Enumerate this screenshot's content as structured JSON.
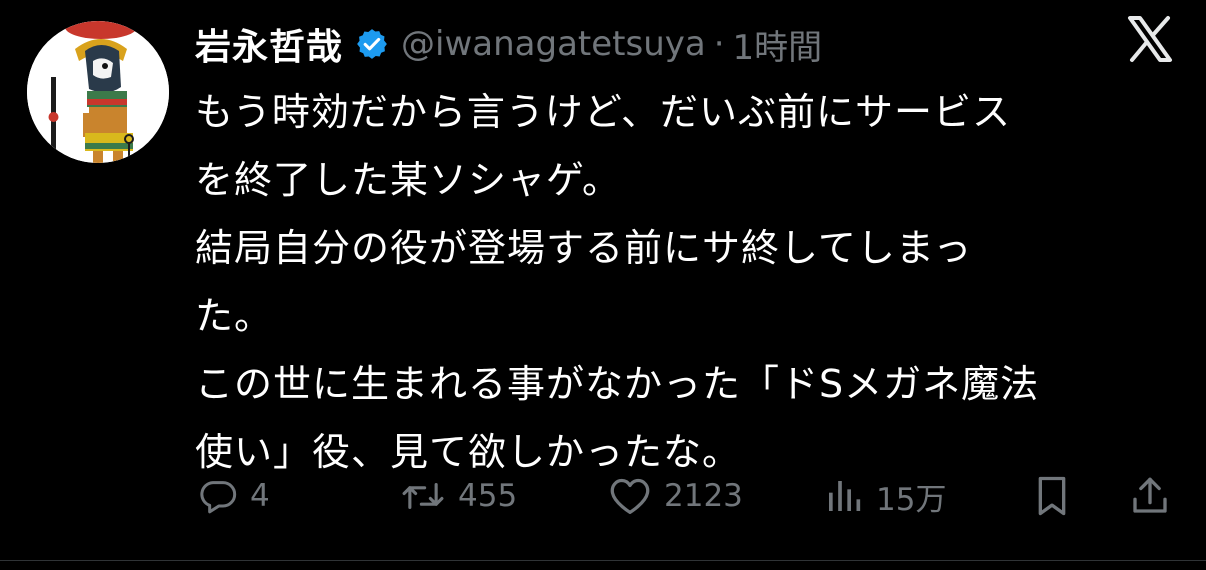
{
  "author": {
    "display_name": "岩永哲哉",
    "handle": "@iwanagatetsuya",
    "separator": "·",
    "time": "1時間",
    "verified": true
  },
  "tweet": {
    "lines": [
      "もう時効だから言うけど、だいぶ前にサービス",
      "を終了した某ソシャゲ。",
      "結局自分の役が登場する前にサ終してしまっ",
      "た。",
      "この世に生まれる事がなかった「ドSメガネ魔法",
      "使い」役、見て欲しかったな。"
    ]
  },
  "actions": {
    "replies": "4",
    "reposts": "455",
    "likes": "2123",
    "views": "15万"
  },
  "icons": {
    "verified": "verified-badge-icon",
    "platform": "x-logo-icon",
    "reply": "reply-icon",
    "repost": "repost-icon",
    "like": "heart-icon",
    "views": "analytics-icon",
    "bookmark": "bookmark-icon",
    "share": "share-icon"
  },
  "colors": {
    "background": "#000000",
    "text": "#ffffff",
    "secondary_text": "#71767b",
    "verified_blue": "#1d9bf0"
  }
}
